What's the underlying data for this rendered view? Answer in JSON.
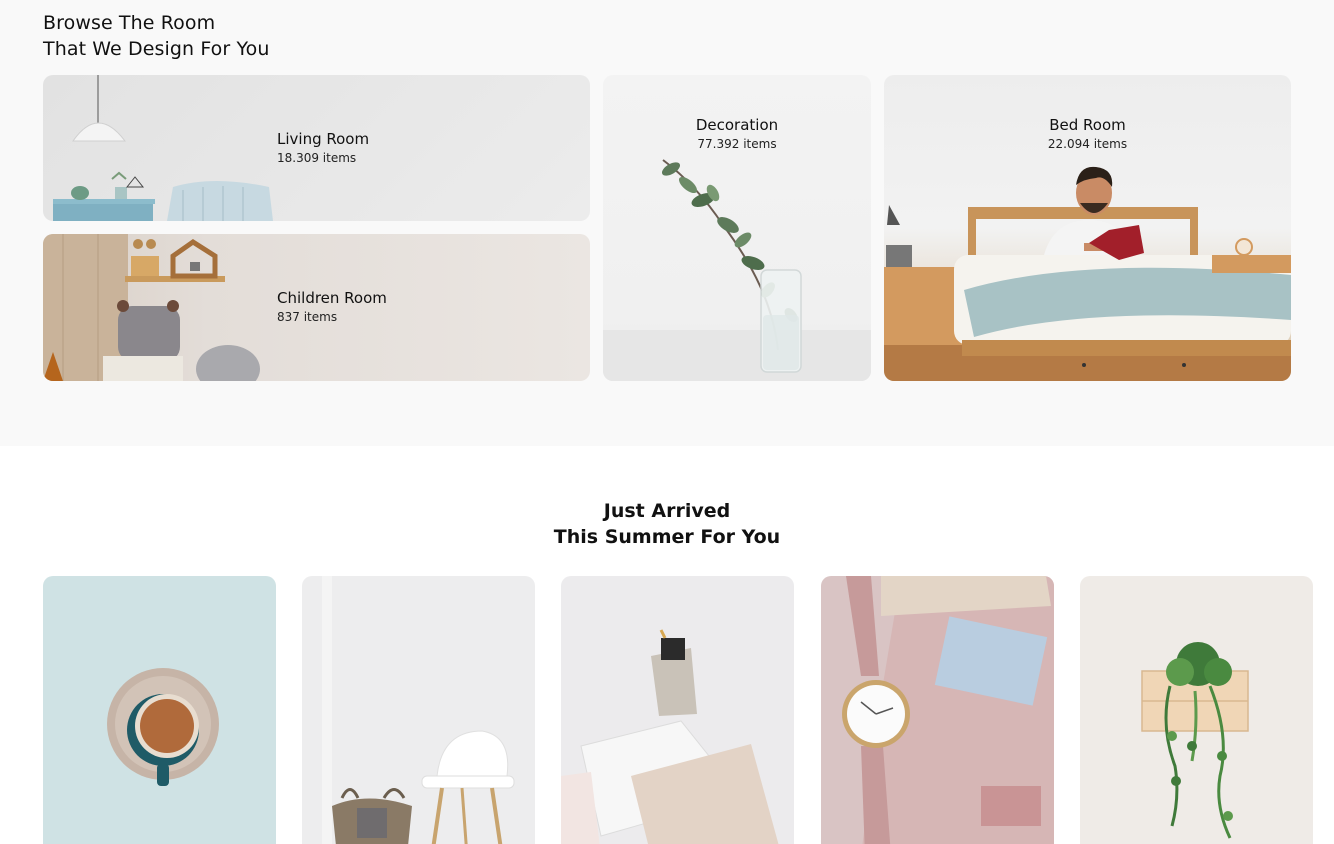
{
  "browse": {
    "title_line1": "Browse The Room",
    "title_line2": "That We Design For You",
    "rooms": [
      {
        "name": "Living Room",
        "count": "18.309 items"
      },
      {
        "name": "Children Room",
        "count": "837 items"
      },
      {
        "name": "Decoration",
        "count": "77.392 items"
      },
      {
        "name": "Bed Room",
        "count": "22.094 items"
      }
    ]
  },
  "arrived": {
    "title_line1": "Just Arrived",
    "title_line2": "This Summer For You"
  },
  "products": [
    {
      "image": "coffee-cup-image"
    },
    {
      "image": "white-chair-basket-image"
    },
    {
      "image": "notebook-pencil-cup-image"
    },
    {
      "image": "watch-notebook-image"
    },
    {
      "image": "hanging-plant-image"
    }
  ],
  "colors": {
    "browse_background": "#f9f9f9",
    "page_background": "#ffffff",
    "text": "#111111"
  }
}
